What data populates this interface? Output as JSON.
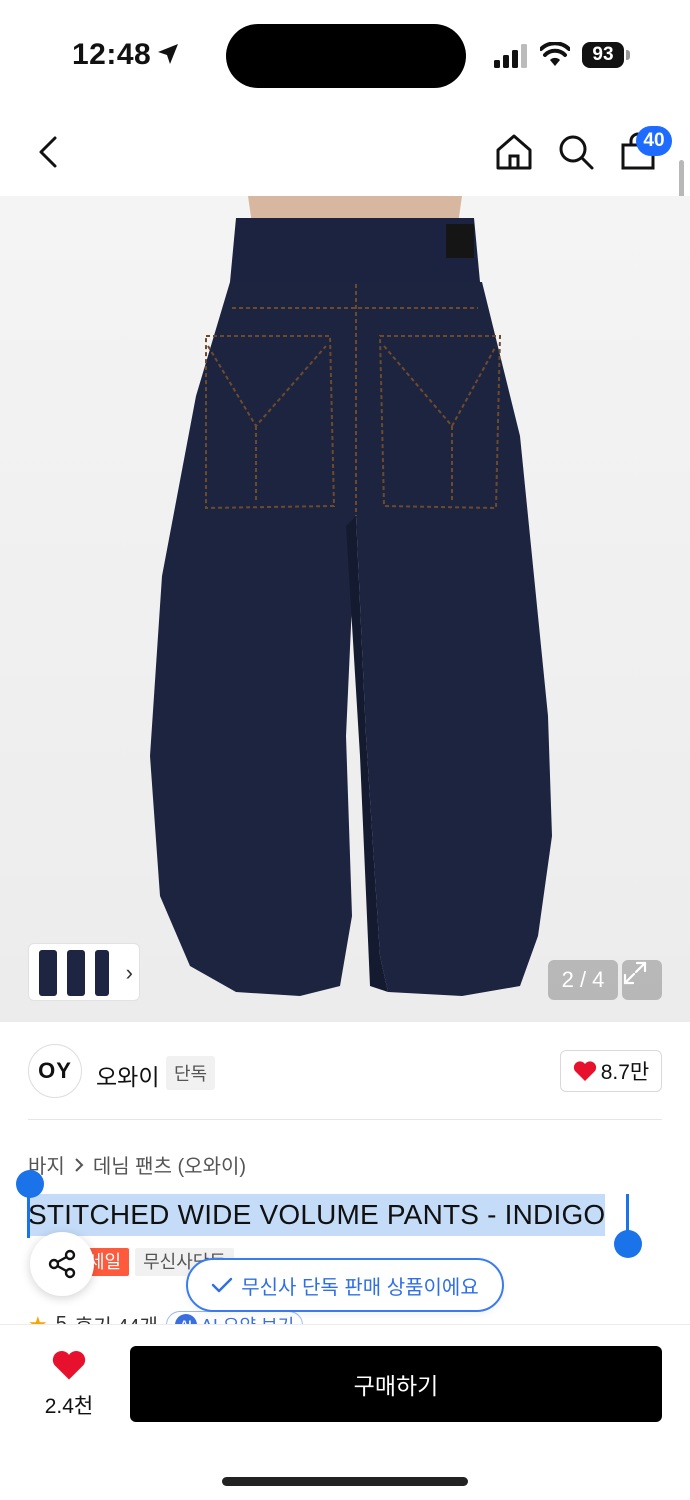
{
  "status_bar": {
    "time": "12:48",
    "battery": "93"
  },
  "nav": {
    "cart_count": "40"
  },
  "gallery": {
    "counter": "2 / 4"
  },
  "brand": {
    "logo_text": "OY",
    "name": "오와이",
    "tag": "단독",
    "likes": "8.7만"
  },
  "breadcrumb": {
    "category": "바지",
    "subcategory": "데님 팬츠 (오와이)"
  },
  "product": {
    "title": "STITCHED WIDE VOLUME PANTS - INDIGO"
  },
  "badges": {
    "sale": "세일",
    "exclusive": "무신사단독"
  },
  "toast": {
    "text": "무신사 단독 판매 상품이에요"
  },
  "rating": {
    "score": "5",
    "reviews": "후기 44개",
    "ai_label": "AI 요약 보기",
    "ai_icon": "AI"
  },
  "bottom": {
    "wish_count": "2.4천",
    "buy_label": "구매하기"
  },
  "colors": {
    "accent_blue": "#1e6bff",
    "sale_red": "#ff5a3c",
    "heart_red": "#e8112d",
    "denim": "#1c2440"
  }
}
